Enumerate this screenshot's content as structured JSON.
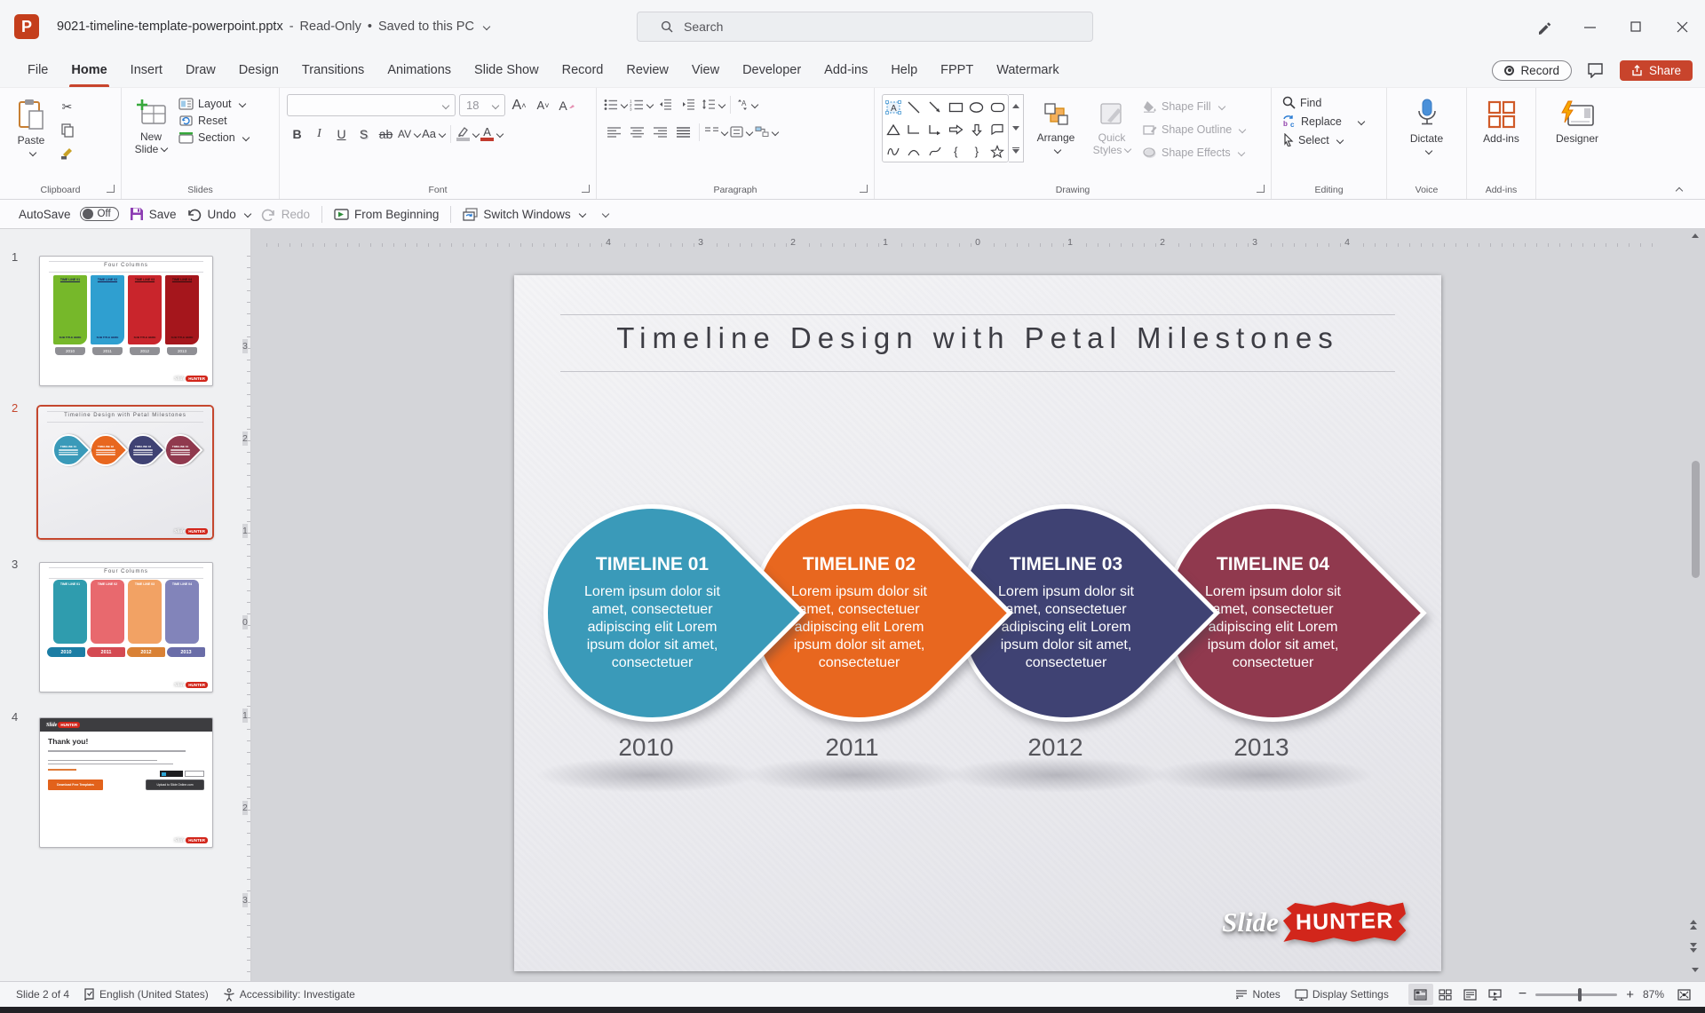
{
  "titlebar": {
    "filename": "9021-timeline-template-powerpoint.pptx",
    "separator": "-",
    "mode": "Read-Only",
    "dot": "•",
    "saved_status": "Saved to this PC",
    "search_placeholder": "Search"
  },
  "menu": {
    "tabs": [
      "File",
      "Home",
      "Insert",
      "Draw",
      "Design",
      "Transitions",
      "Animations",
      "Slide Show",
      "Record",
      "Review",
      "View",
      "Developer",
      "Add-ins",
      "Help",
      "FPPT",
      "Watermark"
    ],
    "active_tab": "Home",
    "record_label": "Record",
    "share_label": "Share"
  },
  "qat": {
    "autosave_label": "AutoSave",
    "autosave_state": "Off",
    "save_label": "Save",
    "undo_label": "Undo",
    "redo_label": "Redo",
    "from_beginning_label": "From Beginning",
    "switch_windows_label": "Switch Windows"
  },
  "ribbon": {
    "clipboard": {
      "paste_label": "Paste",
      "group_label": "Clipboard"
    },
    "slides": {
      "new_slide_line1": "New",
      "new_slide_line2": "Slide",
      "layout_label": "Layout",
      "reset_label": "Reset",
      "section_label": "Section",
      "group_label": "Slides"
    },
    "font": {
      "font_size_value": "18",
      "bold": "B",
      "italic": "I",
      "underline": "U",
      "shadow": "S",
      "strike": "ab",
      "spacing": "AV",
      "case": "Aa",
      "color_letter": "A",
      "group_label": "Font"
    },
    "paragraph": {
      "group_label": "Paragraph"
    },
    "drawing": {
      "arrange_label": "Arrange",
      "quick_styles_line1": "Quick",
      "quick_styles_line2": "Styles",
      "shape_fill_label": "Shape Fill",
      "shape_outline_label": "Shape Outline",
      "shape_effects_label": "Shape Effects",
      "group_label": "Drawing"
    },
    "editing": {
      "find_label": "Find",
      "replace_label": "Replace",
      "select_label": "Select",
      "group_label": "Editing"
    },
    "voice": {
      "dictate_label": "Dictate",
      "group_label": "Voice"
    },
    "addins": {
      "button_label": "Add-ins",
      "group_label": "Add-ins"
    },
    "designer": {
      "button_label": "Designer"
    }
  },
  "rulers": {
    "horizontal": [
      "4",
      "3",
      "2",
      "1",
      "0",
      "1",
      "2",
      "3",
      "4"
    ],
    "vertical": [
      "3",
      "2",
      "1",
      "0",
      "1",
      "2",
      "3"
    ]
  },
  "thumbnails": [
    {
      "number": "1",
      "title": "Four Columns",
      "subtitle": "SUB TITLE HERE",
      "columns": [
        {
          "header": "TIME LINE 01",
          "color": "#76b82a"
        },
        {
          "header": "TIME LINE 02",
          "color": "#2f9fd0"
        },
        {
          "header": "TIME LINE 03",
          "color": "#c9252c"
        },
        {
          "header": "TIME LINE 04",
          "color": "#a5161c"
        }
      ],
      "years": [
        "2010",
        "2011",
        "2012",
        "2013"
      ]
    },
    {
      "number": "2",
      "title": "Timeline Design with Petal Milestones",
      "petal_headings": [
        "TIMELINE 01",
        "TIMELINE 02",
        "TIMELINE 03",
        "TIMELINE 04"
      ],
      "petal_colors": [
        "#3a9ab9",
        "#e8671f",
        "#3f4273",
        "#90394e"
      ],
      "years": [
        "2010",
        "2011",
        "2012",
        "2013"
      ]
    },
    {
      "number": "3",
      "title": "Four Columns",
      "columns": [
        {
          "header": "TIME LINE 01",
          "color": "#2f9cae"
        },
        {
          "header": "TIME LINE 02",
          "color": "#e8696e"
        },
        {
          "header": "TIME LINE 03",
          "color": "#f2a264"
        },
        {
          "header": "TIME LINE 04",
          "color": "#8284ba"
        }
      ],
      "years": [
        "2010",
        "2011",
        "2012",
        "2013"
      ],
      "year_colors": [
        "#1b7da4",
        "#d44a52",
        "#d98135",
        "#6a6da8"
      ]
    },
    {
      "number": "4",
      "title": "Thank you!",
      "logo_slide": "Slide",
      "logo_hunter": "HUNTER",
      "button_orange": "Download Free Templates",
      "button_dark": "Upload to Slide Online.com"
    }
  ],
  "slide": {
    "title": "Timeline Design with Petal Milestones",
    "petals": [
      {
        "heading": "TIMELINE 01",
        "body": "Lorem ipsum dolor sit amet, consectetuer adipiscing elit Lorem ipsum dolor sit amet, consectetuer",
        "year": "2010",
        "color": "#3a9ab9"
      },
      {
        "heading": "TIMELINE 02",
        "body": "Lorem ipsum dolor sit amet, consectetuer adipiscing elit Lorem ipsum dolor sit amet, consectetuer",
        "year": "2011",
        "color": "#e8671f"
      },
      {
        "heading": "TIMELINE 03",
        "body": "Lorem ipsum dolor sit amet, consectetuer adipiscing elit Lorem ipsum dolor sit amet, consectetuer",
        "year": "2012",
        "color": "#3f4273"
      },
      {
        "heading": "TIMELINE 04",
        "body": "Lorem ipsum dolor sit amet, consectetuer adipiscing elit Lorem ipsum dolor sit amet, consectetuer",
        "year": "2013",
        "color": "#90394e"
      }
    ],
    "logo": {
      "slide_text": "Slide",
      "hunter_text": "HUNTER"
    }
  },
  "statusbar": {
    "slide_info": "Slide 2 of 4",
    "language": "English (United States)",
    "accessibility": "Accessibility: Investigate",
    "notes_label": "Notes",
    "display_settings_label": "Display Settings",
    "zoom_level": "87%"
  },
  "colors": {
    "accent_red": "#c8442c",
    "selected_thumb_border": "#c5472e",
    "logo_red": "#d2261b"
  }
}
